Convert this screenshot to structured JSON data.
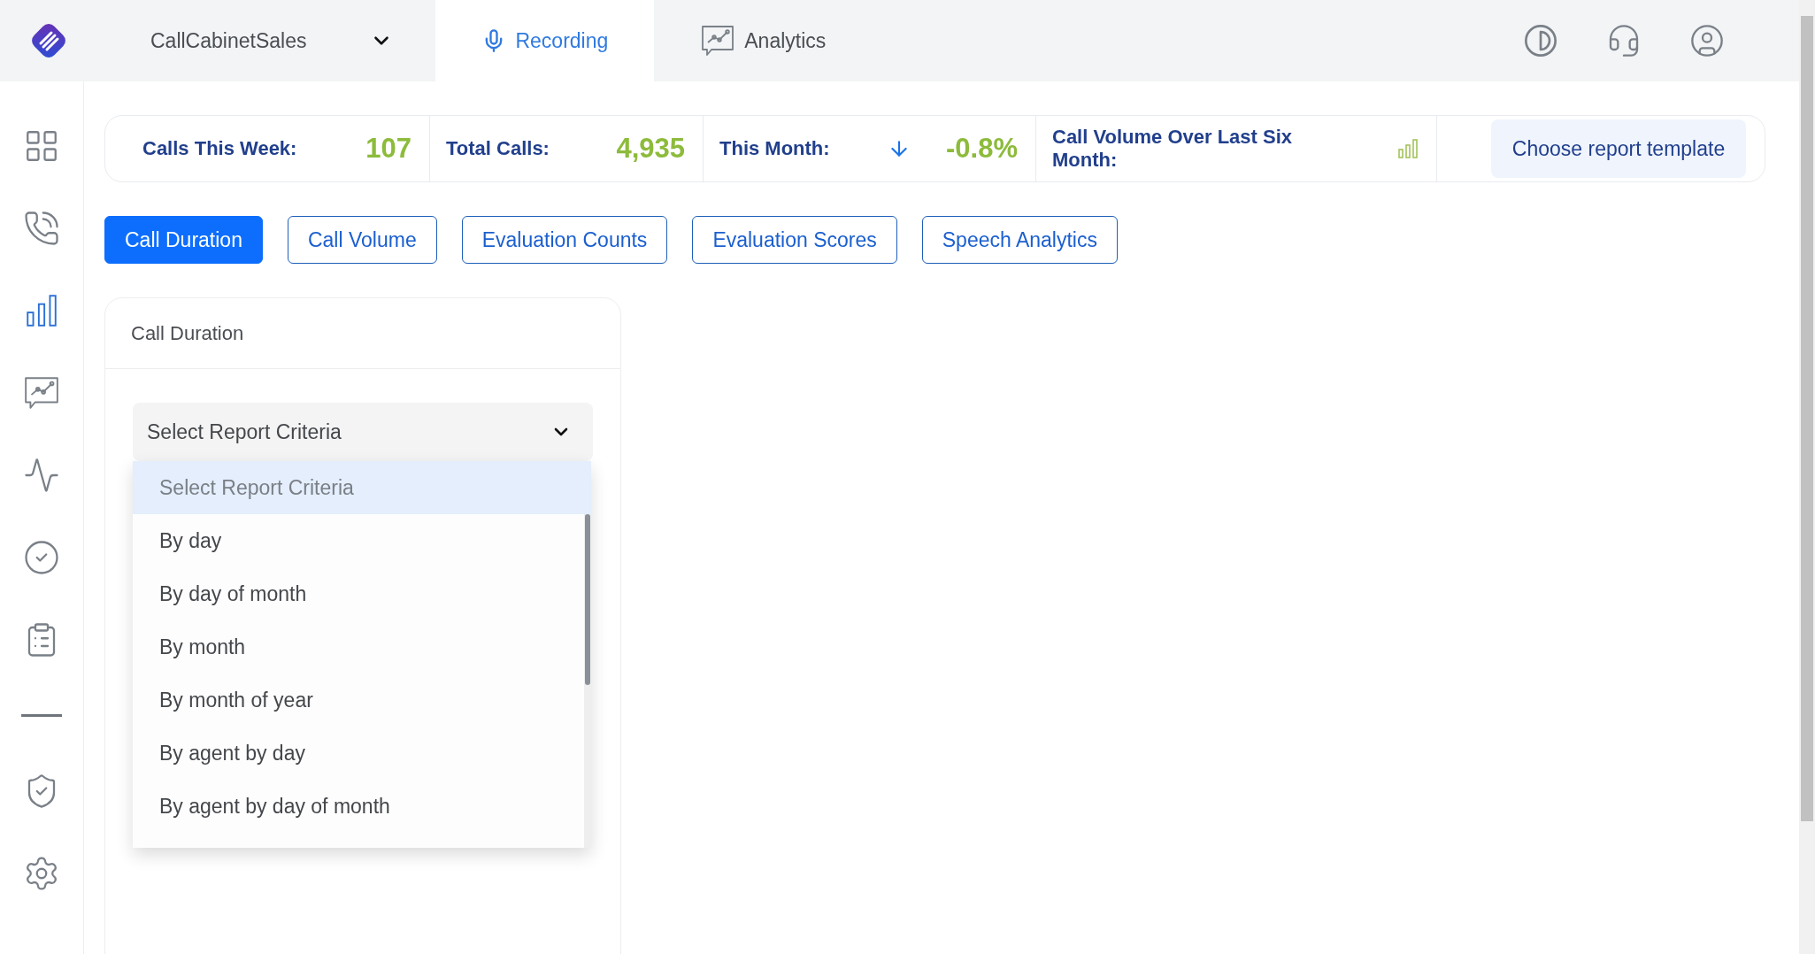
{
  "top_bar": {
    "workspace": "CallCabinetSales",
    "tabs": [
      {
        "label": "Recording",
        "selected": true
      },
      {
        "label": "Analytics",
        "selected": false
      }
    ]
  },
  "sidebar": {
    "items": [
      {
        "kind": "icon",
        "selected": false
      },
      {
        "kind": "icon",
        "selected": false
      },
      {
        "kind": "icon",
        "selected": true
      },
      {
        "kind": "icon",
        "selected": false
      },
      {
        "kind": "icon",
        "selected": false
      },
      {
        "kind": "icon",
        "selected": false
      },
      {
        "kind": "icon",
        "selected": false
      },
      {
        "kind": "divider"
      },
      {
        "kind": "icon",
        "selected": false
      },
      {
        "kind": "icon",
        "selected": false
      }
    ]
  },
  "stats": [
    {
      "kind": "number",
      "label": "Calls This Week:",
      "value": "107"
    },
    {
      "kind": "number",
      "label": "Total Calls:",
      "value": "4,935"
    },
    {
      "kind": "trend_down",
      "label": "This Month:",
      "value": "-0.8%"
    },
    {
      "kind": "chart",
      "label": "Call Volume Over Last Six Month:"
    }
  ],
  "template_button": "Choose report template",
  "report_tabs": [
    {
      "label": "Call Duration",
      "selected": true
    },
    {
      "label": "Call Volume",
      "selected": false
    },
    {
      "label": "Evaluation Counts",
      "selected": false
    },
    {
      "label": "Evaluation Scores",
      "selected": false
    },
    {
      "label": "Speech Analytics",
      "selected": false
    }
  ],
  "panel": {
    "title": "Call Duration",
    "select": {
      "value": "Select Report Criteria",
      "expanded": true,
      "options": [
        {
          "label": "Select Report Criteria",
          "selected": true
        },
        {
          "label": "By day",
          "selected": false
        },
        {
          "label": "By day of month",
          "selected": false
        },
        {
          "label": "By month",
          "selected": false
        },
        {
          "label": "By month of year",
          "selected": false
        },
        {
          "label": "By agent by day",
          "selected": false
        },
        {
          "label": "By agent by day of month",
          "selected": false
        }
      ]
    }
  }
}
